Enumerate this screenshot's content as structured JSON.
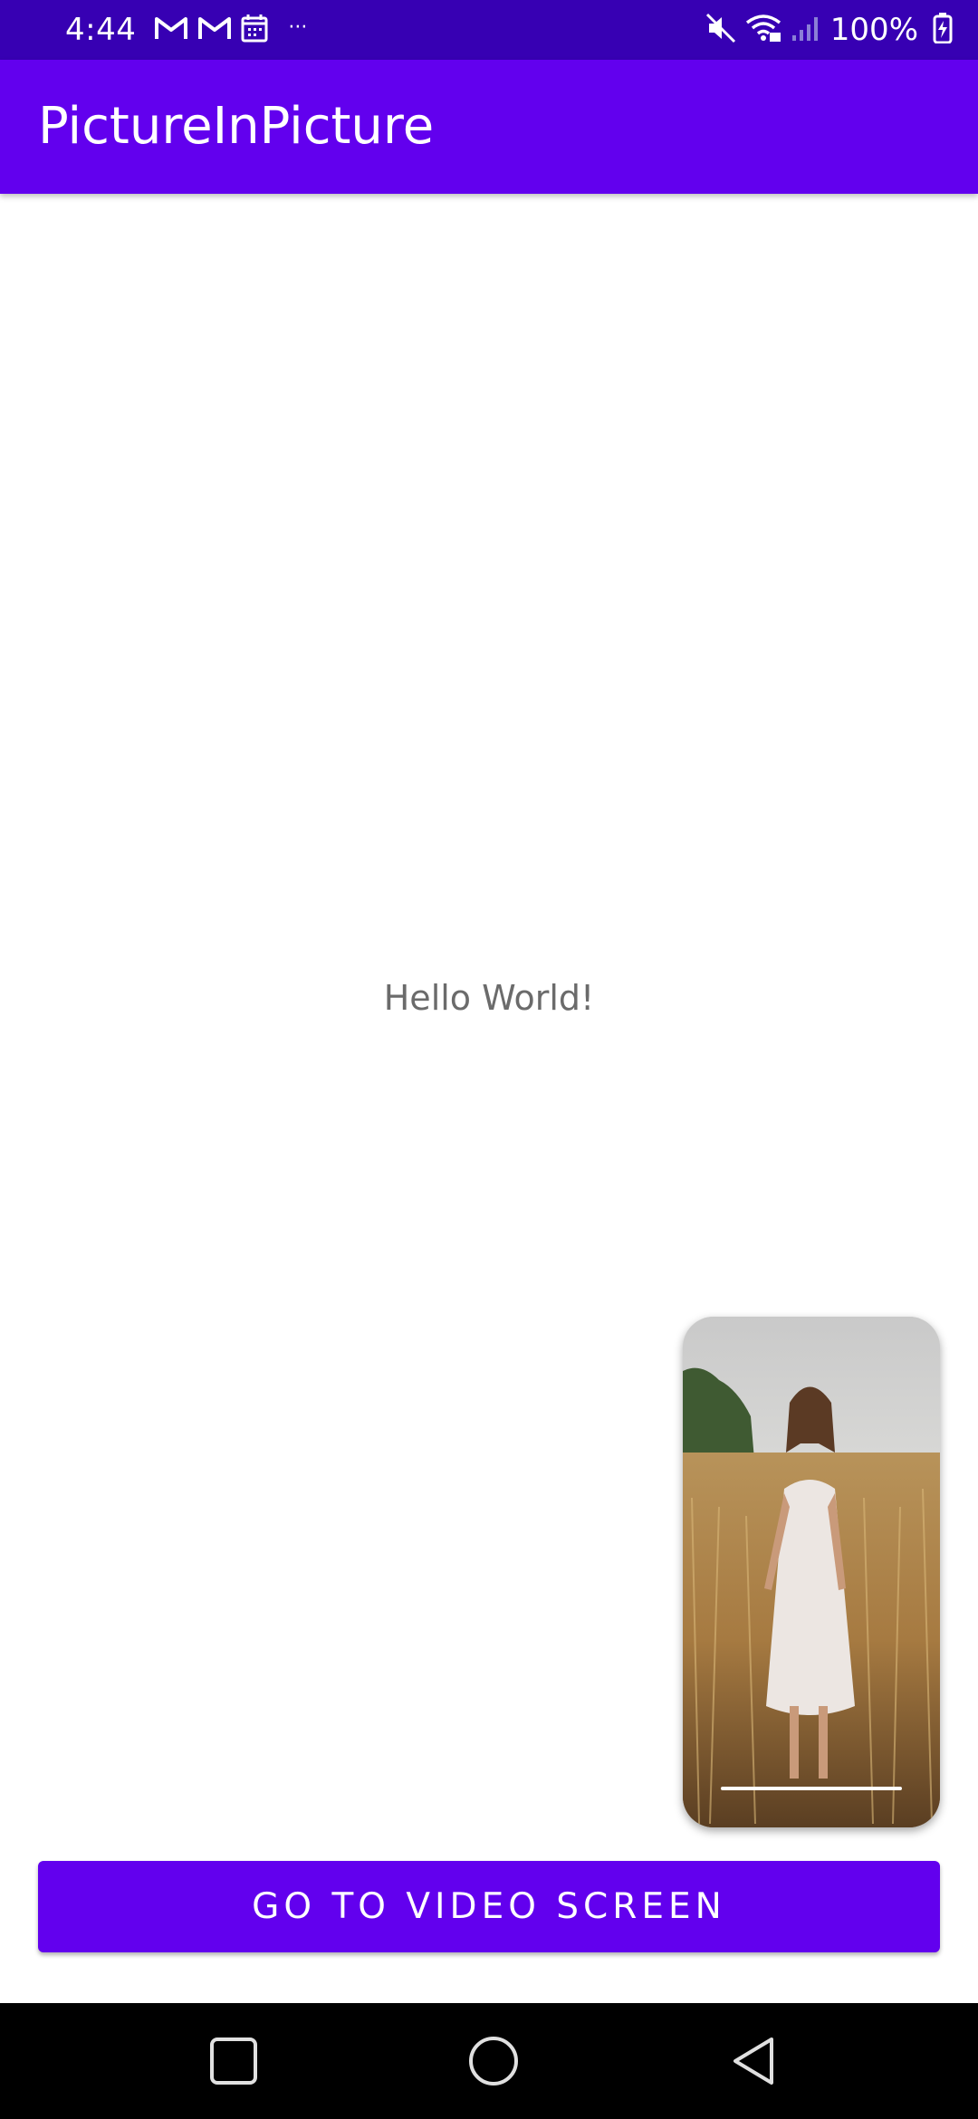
{
  "status_bar": {
    "time": "4:44",
    "battery": "100%",
    "icons_left": [
      "gmail-icon",
      "gmail-icon",
      "calendar-icon",
      "more-notifications-icon"
    ],
    "icons_right": [
      "mute-icon",
      "wifi-icon",
      "signal-icon",
      "battery-charging-icon"
    ],
    "more_indicator": "···"
  },
  "app_bar": {
    "title": "PictureInPicture",
    "color": "#6200ee"
  },
  "main": {
    "hello_text": "Hello World!"
  },
  "pip": {
    "description": "picture-in-picture video window"
  },
  "action_button": {
    "label": "GO TO VIDEO SCREEN",
    "color": "#6200ee"
  },
  "nav_bar": {
    "buttons": [
      "recents-icon",
      "home-icon",
      "back-icon"
    ]
  },
  "colors": {
    "status_bar": "#3700b3",
    "primary": "#6200ee",
    "text_secondary": "#6b6b6b"
  }
}
